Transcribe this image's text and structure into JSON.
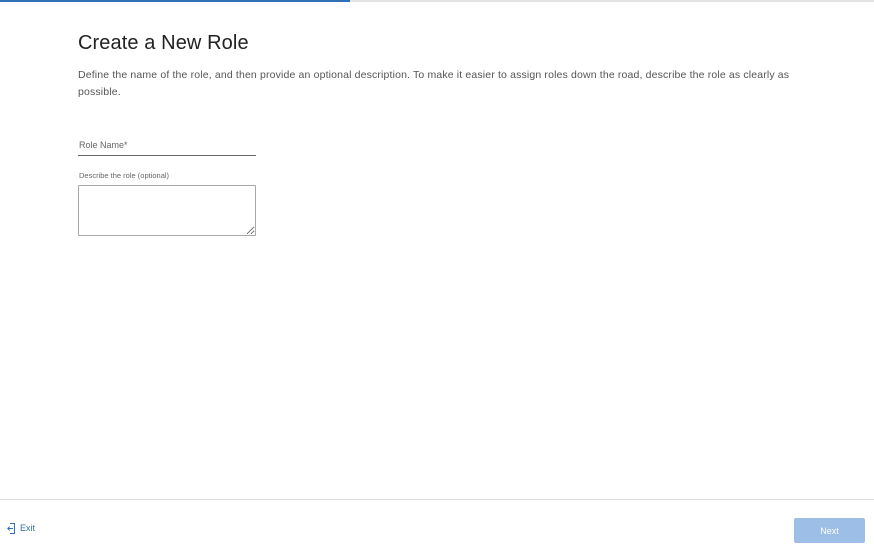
{
  "progress": {
    "value": 0.4,
    "fill_color": "#2f6fb6"
  },
  "header": {
    "title": "Create a New Role",
    "description": "Define the name of the role, and then provide an optional description. To make it easier to assign roles down the road, describe the role as clearly as possible."
  },
  "form": {
    "role_name": {
      "placeholder": "Role Name*",
      "value": ""
    },
    "description": {
      "label": "Describe the role (optional)",
      "value": ""
    }
  },
  "footer": {
    "exit_label": "Exit",
    "exit_icon": "exit-door-icon",
    "next_label": "Next",
    "next_disabled": true
  },
  "colors": {
    "accent": "#2f6fb6",
    "next_disabled_bg": "#9dbfe7"
  }
}
